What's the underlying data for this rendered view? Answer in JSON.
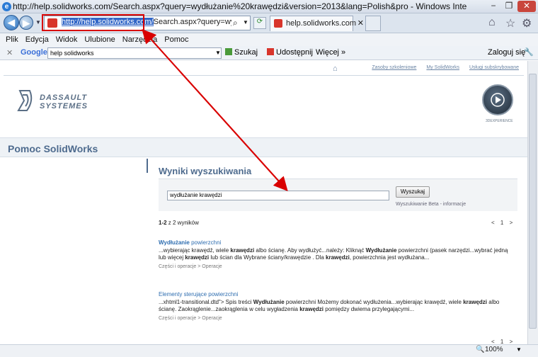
{
  "window": {
    "title": "http://help.solidworks.com/Search.aspx?query=wydłużanie%20krawędzi&version=2013&lang=Polish&pro - Windows Internet Explorer",
    "minimize": "−",
    "restore": "❐",
    "close": "✕"
  },
  "address": {
    "selected": "http://help.solidworks.com/",
    "rest": "Search.aspx?query=wyd%C"
  },
  "tab": {
    "label": "help.solidworks.com"
  },
  "menu": [
    "Plik",
    "Edycja",
    "Widok",
    "Ulubione",
    "Narzędzia",
    "Pomoc"
  ],
  "googlebar": {
    "brand": "Google",
    "query": "help solidworks",
    "search": "Szukaj",
    "share": "Udostępnij",
    "more": "Więcej »",
    "login": "Zaloguj się"
  },
  "page": {
    "topnav": [
      "Zasoby szkoleniowe",
      "My SolidWorks",
      "Usługi subskrybowane"
    ],
    "logo_line1": "DASSAULT",
    "logo_line2": "SYSTEMES",
    "experience": "3DEXPERIENCE",
    "banner": "Pomoc SolidWorks",
    "section_title": "Wyniki wyszukiwania",
    "search_value": "wydłużanie krawędzi",
    "search_button": "Wyszukaj",
    "beta_link": "Wyszukiwanie Beta - informacje",
    "count": {
      "range": "1-2",
      "rest": " z 2 wyników"
    },
    "pager": "< 1 >",
    "results": [
      {
        "title_bold": "Wydłużanie",
        "title_rest": " powierzchni",
        "snip": "...wybierając krawędź, wiele krawędzi albo ścianę. Aby wydłużyć...należy: Kliknąć Wydłużanie powierzchni (pasek narzędzi...wybrać jedną lub więcej krawędzi lub ścian dla Wybrane ściany/krawędzie . Dla krawędzi, powierzchnia jest wydłużana...",
        "path": "Części i operacje > Operacje"
      },
      {
        "title_bold": "",
        "title_rest": "Elementy sterujące powierzchni",
        "snip": "...xhtml1-transitional.dtd\"> Spis treści Wydłużanie powierzchni Możemy dokonać wydłużenia...wybierając krawędź, wiele krawędzi albo ścianę. Zaokrąglenie...zaokrąglenia w celu wygładzenia krawędzi pomiędzy dwiema przylegającymi...",
        "path": "Części i operacje > Operacje"
      }
    ],
    "pager_bottom": "< 1 >"
  },
  "status": {
    "zoom": "100%"
  }
}
